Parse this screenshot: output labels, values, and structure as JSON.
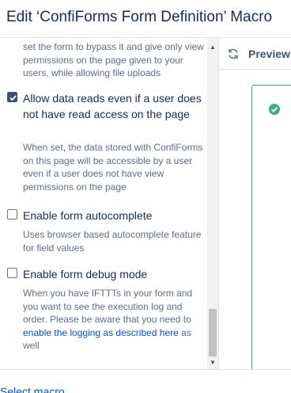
{
  "dialog": {
    "title": "Edit ‘ConfiForms Form Definition’ Macro"
  },
  "options": {
    "top_desc": "set the form to bypass it and give only view permissions on the page given to your users, while allowing file uploads",
    "items": [
      {
        "label": "Allow data reads even if a user does not have read access on the page",
        "checked": true,
        "description": "When set, the data stored with ConfiForms on this page will be accessible by a user even if a user does not have view permissions on the page"
      },
      {
        "label": "Enable form autocomplete",
        "checked": false,
        "description": "Uses browser based autocomplete feature for field values"
      },
      {
        "label": "Enable form debug mode",
        "checked": false,
        "description_before_link": "When you have IFTTTs in your form and you want to see the execution log and order. Please be aware that you need to ",
        "description_link": "enable the logging as described here",
        "description_after_link": " as well"
      }
    ]
  },
  "preview": {
    "label": "Preview",
    "icon": "refresh-icon",
    "status_icon": "success-check-icon"
  },
  "footer": {
    "select_macro_label": "Select macro"
  },
  "scrollbar": {
    "position_fraction": 0.92
  },
  "colors": {
    "link": "#0052cc",
    "success": "#36b37e",
    "checkbox_checked": "#42526e"
  }
}
